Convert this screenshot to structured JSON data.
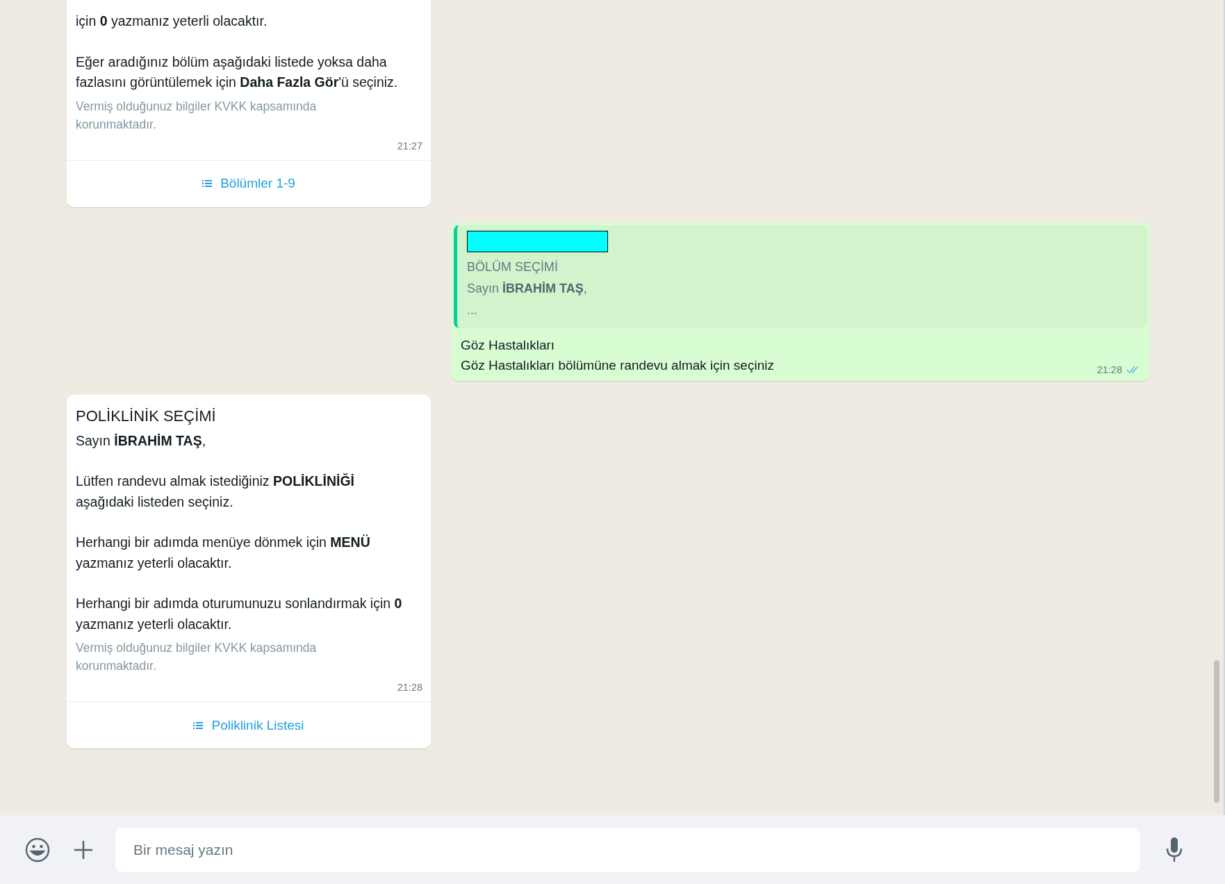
{
  "messages": [
    {
      "kind": "incoming",
      "paragraphs": [
        "için **0** yazmanız yeterli olacaktır.",
        "Eğer aradığınız bölüm aşağıdaki listede yoksa daha fazlasını görüntülemek için **Daha Fazla Gör**'ü seçiniz."
      ],
      "footer": "Vermiş olduğunuz bilgiler KVKK kapsamında korunmaktadır.",
      "time": "21:27",
      "list_button": "Bölümler 1-9"
    },
    {
      "kind": "outgoing",
      "quote": {
        "title": "BÖLÜM SEÇİMİ",
        "lines": [
          "Sayın **İBRAHİM TAŞ**,",
          "..."
        ]
      },
      "lines": [
        "Göz Hastalıkları",
        "Göz Hastalıkları bölümüne randevu almak için seçiniz"
      ],
      "time": "21:28",
      "read": true
    },
    {
      "kind": "incoming",
      "title": "POLİKLİNİK SEÇİMİ",
      "paragraphs": [
        "Sayın **İBRAHİM TAŞ**,",
        "Lütfen randevu almak istediğiniz **POLİKLİNİĞİ** aşağıdaki listeden seçiniz.",
        "Herhangi bir adımda menüye dönmek için **MENÜ** yazmanız yeterli olacaktır.",
        "Herhangi bir adımda oturumunuzu sonlandırmak için **0** yazmanız yeterli olacaktır."
      ],
      "footer": "Vermiş olduğunuz bilgiler KVKK kapsamında korunmaktadır.",
      "time": "21:28",
      "list_button": "Poliklinik Listesi"
    }
  ],
  "composer": {
    "placeholder": "Bir mesaj yazın"
  }
}
